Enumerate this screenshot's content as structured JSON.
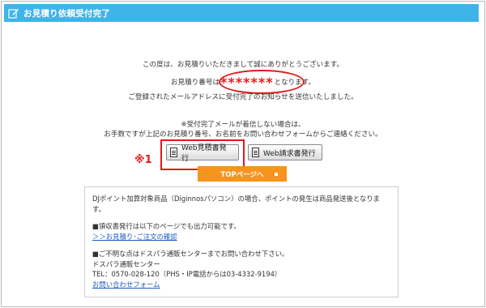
{
  "title": "お見積り依頼受付完了",
  "icons": {
    "title_icon": "edit-pen-icon",
    "document_icon": "document-icon"
  },
  "colors": {
    "title_bar": "#3fb4e8",
    "highlight": "#e01a1a",
    "top_button": "#f7941d",
    "link": "#1a5bbf"
  },
  "messages": {
    "thanks": "この度は、お見積りいただきまして誠にありがとうございます。",
    "estimate_prefix": "お見積り番号は",
    "estimate_number": "*******",
    "estimate_suffix": "となります。",
    "email_sent": "ご登録されたメールアドレスに受付完了のお知らせを送信いたしました。",
    "no_email_1": "※受付完了メールが着信しない場合は、",
    "no_email_2": "お手数ですが上記のお見積り番号、お名前をお問い合わせフォームからご連絡ください。"
  },
  "annotation": "※1",
  "buttons": {
    "web_estimate": "Web見積書発行",
    "web_invoice": "Web請求書発行",
    "top_page": "TOPページへ"
  },
  "info": {
    "points": "DJポイント加算対象商品（Diginnosパソコン）の場合、ポイントの発生は商品発送後となります。",
    "receipt": "■領収書発行は以下のページでも出力可能です。",
    "receipt_link": "＞＞お見積り･ご注文の確認",
    "inquiry": "■ご不明な点はドスパラ通販センターまでお問い合わせ下さい。",
    "center": "ドスパラ通販センター",
    "tel": "TEL：0570-028-120（PHS・IP電話からは03-4332-9194）",
    "form_link": "お問い合わせフォーム"
  }
}
